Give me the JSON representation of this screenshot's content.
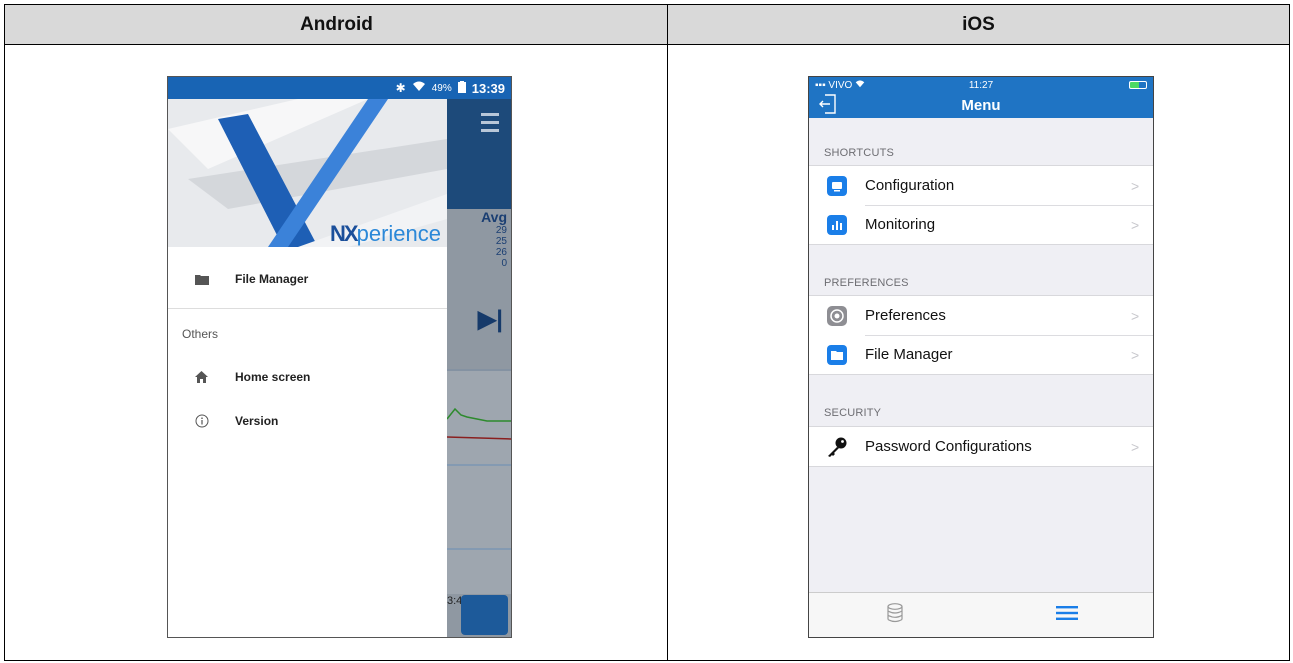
{
  "table": {
    "header_left": "Android",
    "header_right": "iOS"
  },
  "android": {
    "status": {
      "battery": "49%",
      "time": "13:39"
    },
    "logo_prefix": "NX",
    "logo_suffix": "perience",
    "behind": {
      "avg_label": "Avg",
      "avg_values": [
        "29",
        "25",
        "26",
        "0"
      ],
      "time_label": "3:40"
    },
    "menu": {
      "file_manager": "File Manager",
      "others_section": "Others",
      "home_screen": "Home screen",
      "version": "Version"
    }
  },
  "ios": {
    "status": {
      "carrier": "VIVO",
      "time": "11:27"
    },
    "nav_title": "Menu",
    "sections": {
      "shortcuts": "SHORTCUTS",
      "preferences": "PREFERENCES",
      "security": "SECURITY"
    },
    "rows": {
      "configuration": "Configuration",
      "monitoring": "Monitoring",
      "preferences": "Preferences",
      "file_manager": "File Manager",
      "password_configurations": "Password Configurations"
    },
    "tabs": {
      "active": "menu-tab",
      "icons": [
        "database-icon",
        "hamburger-menu-icon"
      ]
    },
    "colors": {
      "nav_blue": "#1f74c4",
      "tab_active": "#1a7ee8"
    }
  }
}
